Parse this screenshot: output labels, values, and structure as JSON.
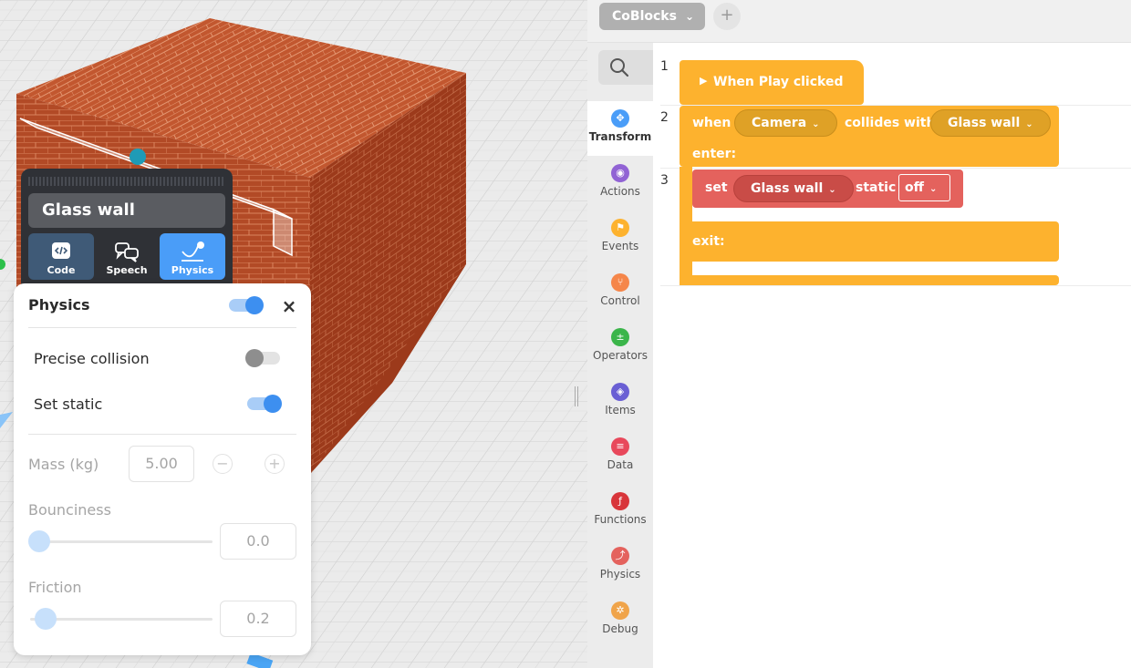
{
  "object_panel": {
    "name": "Glass wall",
    "tabs": [
      {
        "label": "Code",
        "icon": "code-icon"
      },
      {
        "label": "Speech",
        "icon": "speech-icon"
      },
      {
        "label": "Physics",
        "icon": "physics-icon",
        "active": true
      }
    ]
  },
  "physics_panel": {
    "title": "Physics",
    "enabled": true,
    "close_icon": "×",
    "precise_collision": {
      "label": "Precise collision",
      "on": false
    },
    "set_static": {
      "label": "Set static",
      "on": true
    },
    "mass": {
      "label": "Mass (kg)",
      "value": "5.00",
      "minus": "−",
      "plus": "+"
    },
    "bounciness": {
      "label": "Bounciness",
      "value": "0.0"
    },
    "friction": {
      "label": "Friction",
      "value": "0.2"
    }
  },
  "editor": {
    "file_tab": "CoBlocks",
    "add_tab_label": "+",
    "categories": [
      {
        "label": "Transform",
        "color": "#4a9df8",
        "icon": "transform-icon",
        "active": true
      },
      {
        "label": "Actions",
        "color": "#9163d4",
        "icon": "eye-icon"
      },
      {
        "label": "Events",
        "color": "#fdb22e",
        "icon": "flag-icon"
      },
      {
        "label": "Control",
        "color": "#f5864a",
        "icon": "branch-icon"
      },
      {
        "label": "Operators",
        "color": "#3bb54a",
        "icon": "operators-icon"
      },
      {
        "label": "Items",
        "color": "#6a5fd4",
        "icon": "cube-icon"
      },
      {
        "label": "Data",
        "color": "#e8485b",
        "icon": "database-icon"
      },
      {
        "label": "Functions",
        "color": "#d8353a",
        "icon": "function-icon"
      },
      {
        "label": "Physics",
        "color": "#e4625d",
        "icon": "physics-icon"
      },
      {
        "label": "Debug",
        "color": "#f0a44a",
        "icon": "bug-icon"
      }
    ],
    "line_numbers": [
      "1",
      "2",
      "3"
    ],
    "blocks": {
      "play": "When Play clicked",
      "when": "when",
      "camera": "Camera",
      "collides_with": "collides with",
      "target": "Glass wall",
      "enter": "enter:",
      "set": "set",
      "set_target": "Glass wall",
      "static": "static",
      "static_value": "off",
      "exit": "exit:"
    }
  }
}
